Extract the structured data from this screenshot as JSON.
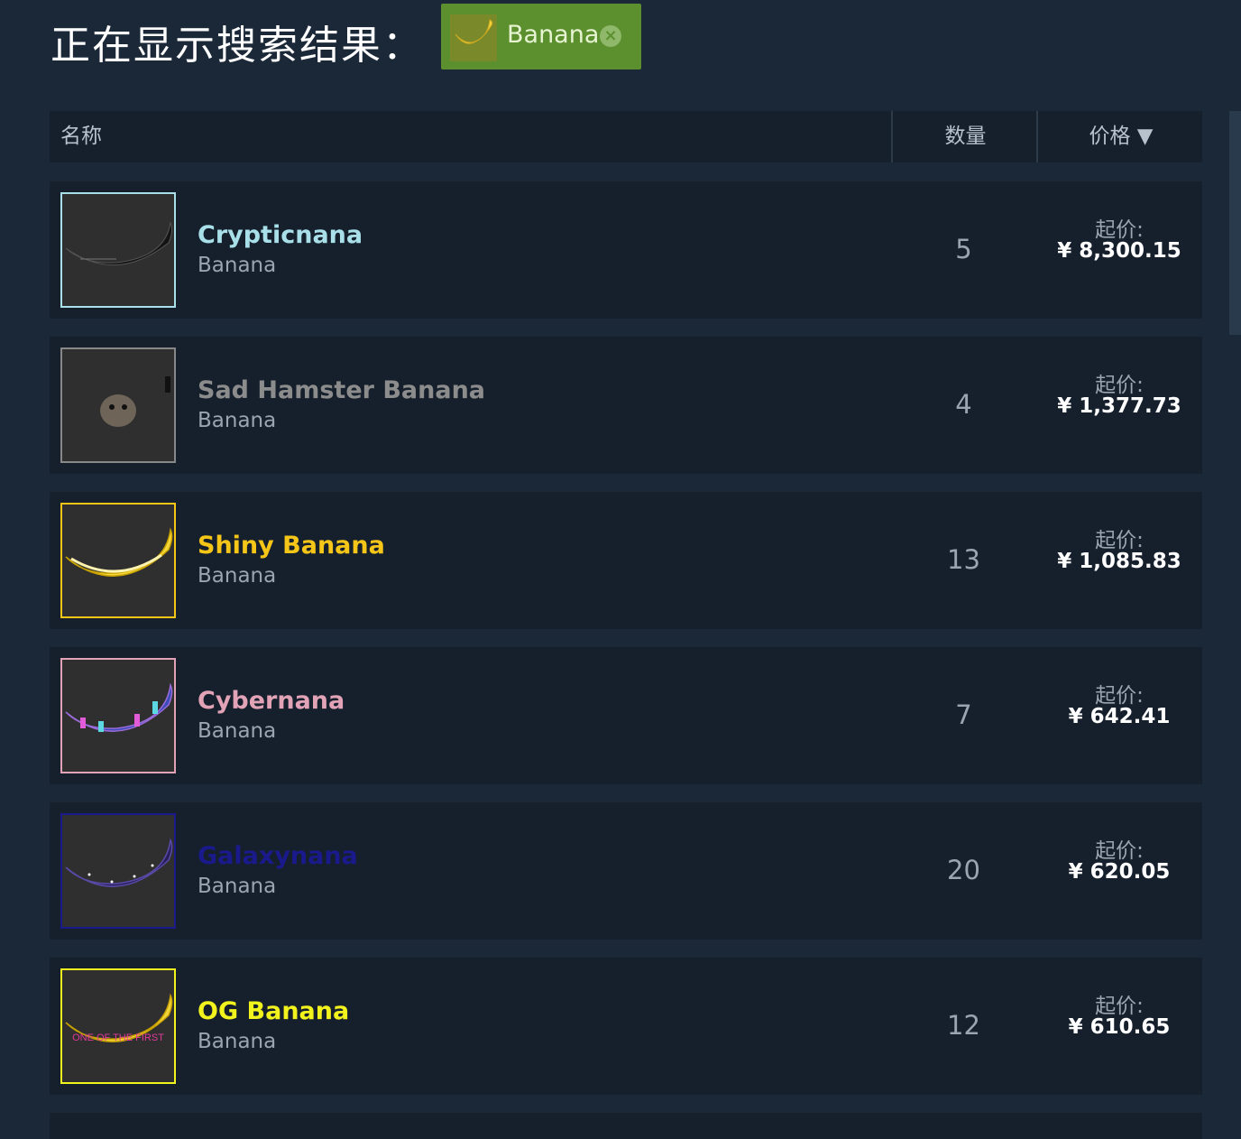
{
  "header": {
    "title": "正在显示搜索结果：",
    "filter_label": "Banana",
    "filter_close": "×"
  },
  "table": {
    "col_name": "名称",
    "col_qty": "数量",
    "col_price": "价格 ▼"
  },
  "items": [
    {
      "name": "Crypticnana",
      "game": "Banana",
      "qty": "5",
      "price_label": "起价:",
      "price": "¥ 8,300.15",
      "color": "#a8dfe8"
    },
    {
      "name": "Sad Hamster Banana",
      "game": "Banana",
      "qty": "4",
      "price_label": "起价:",
      "price": "¥ 1,377.73",
      "color": "#8c8c8c"
    },
    {
      "name": "Shiny Banana",
      "game": "Banana",
      "qty": "13",
      "price_label": "起价:",
      "price": "¥ 1,085.83",
      "color": "#f5c518"
    },
    {
      "name": "Cybernana",
      "game": "Banana",
      "qty": "7",
      "price_label": "起价:",
      "price": "¥ 642.41",
      "color": "#e2a3b6"
    },
    {
      "name": "Galaxynana",
      "game": "Banana",
      "qty": "20",
      "price_label": "起价:",
      "price": "¥ 620.05",
      "color": "#1a1a8c"
    },
    {
      "name": "OG Banana",
      "game": "Banana",
      "qty": "12",
      "price_label": "起价:",
      "price": "¥ 610.65",
      "color": "#f2f21c"
    }
  ],
  "thumb_art": {
    "og_banana_text": "ONE OF THE FIRST"
  }
}
